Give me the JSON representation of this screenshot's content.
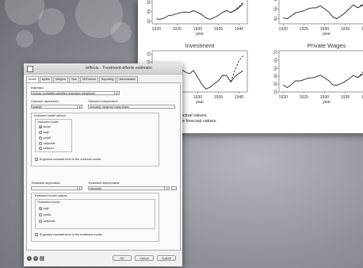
{
  "graph": {
    "panels": [
      {
        "title": "",
        "yticks": [
          "40",
          "60",
          "80"
        ],
        "xticks": [
          "1920",
          "1925",
          "1930",
          "1935",
          "1940"
        ],
        "xlabel": "year"
      },
      {
        "title": "",
        "yticks": [
          "40",
          "50",
          "60"
        ],
        "xticks": [
          "1920",
          "1925",
          "1930",
          "1935",
          "1940"
        ],
        "xlabel": "year"
      },
      {
        "title": "Investment",
        "yticks": [
          "-5",
          "0",
          "5",
          "10",
          "15"
        ],
        "xticks": [
          "1920",
          "1925",
          "1930",
          "1935",
          "1940"
        ],
        "xlabel": "year"
      },
      {
        "title": "Private Wages",
        "yticks": [
          "20",
          "30",
          "40",
          "50",
          "60",
          "70"
        ],
        "xticks": [
          "1920",
          "1925",
          "1930",
          "1935",
          "1940"
        ],
        "xlabel": "year"
      }
    ],
    "note_line1": "Solid lines denote actual values.",
    "note_line2": "Dashed lines denote forecast values."
  },
  "dialog": {
    "title": "teffects - Treatment-effects estimatio",
    "tabs": [
      "Model",
      "by/if/in",
      "Weights",
      "Stat",
      "SE/Robust",
      "Reporting",
      "Maximization"
    ],
    "estimator_label": "Estimator",
    "estimator_value": "Inverse-probability-weighted regression adjustment",
    "outcome_dependent_label": "Outcome dependent:",
    "outcome_dependent_value": "bweight",
    "outcome_independent_label": "Outcome independent:",
    "outcome_independent_value": "prenatal1 mmarried mage fbaby",
    "outcome_model_options_label": "Outcome model options",
    "outcome_model_label": "Outcome model",
    "outcome_models": [
      "linear",
      "logit",
      "probit",
      "hetprobit",
      "poisson"
    ],
    "suppress_outcome_label": "Suppress constant term in the outcome model",
    "treatment_dependent_label": "Treatment dependent:",
    "treatment_independent_label": "Treatment independent:",
    "treatment_independent_value": "mbsmoke",
    "treatment_model_options_label": "Treatment model options",
    "treatment_model_label": "Treatment model",
    "treatment_models": [
      "logit",
      "probit",
      "hetprobit"
    ],
    "suppress_treatment_label": "Suppress constant term in the treatment model",
    "ok_label": "OK",
    "cancel_label": "Cancel",
    "submit_label": "Submit",
    "ellipsis_label": "..."
  },
  "chart_data": [
    {
      "type": "line",
      "title": "",
      "xlabel": "year",
      "ylim": [
        35,
        90
      ],
      "x": [
        1920,
        1921,
        1922,
        1923,
        1924,
        1925,
        1926,
        1927,
        1928,
        1929,
        1930,
        1931,
        1932,
        1933,
        1934,
        1935,
        1936,
        1937,
        1938,
        1939,
        1940,
        1941
      ],
      "series": [
        {
          "values": [
            45,
            44,
            47,
            52,
            53,
            56,
            58,
            59,
            58,
            62,
            58,
            54,
            47,
            44,
            48,
            52,
            58,
            62,
            58,
            62,
            68,
            76
          ]
        },
        {
          "values": [
            null,
            null,
            null,
            null,
            null,
            null,
            null,
            null,
            null,
            null,
            null,
            null,
            null,
            null,
            null,
            null,
            null,
            null,
            58,
            63,
            70,
            79
          ]
        }
      ]
    },
    {
      "type": "line",
      "title": "",
      "xlabel": "year",
      "ylim": [
        35,
        62
      ],
      "x": [
        1920,
        1921,
        1922,
        1923,
        1924,
        1925,
        1926,
        1927,
        1928,
        1929,
        1930,
        1931,
        1932,
        1933,
        1934,
        1935,
        1936,
        1937,
        1938,
        1939,
        1940,
        1941
      ],
      "series": [
        {
          "values": [
            41,
            40,
            43,
            46,
            47,
            48,
            50,
            51,
            51,
            53,
            50,
            47,
            42,
            40,
            43,
            46,
            50,
            54,
            51,
            53,
            56,
            60
          ]
        },
        {
          "values": [
            null,
            null,
            null,
            null,
            null,
            null,
            null,
            null,
            null,
            null,
            null,
            null,
            null,
            null,
            null,
            null,
            null,
            null,
            51,
            54,
            57,
            61
          ]
        }
      ]
    },
    {
      "type": "line",
      "title": "Investment",
      "xlabel": "year",
      "ylim": [
        -8,
        17
      ],
      "x": [
        1920,
        1921,
        1922,
        1923,
        1924,
        1925,
        1926,
        1927,
        1928,
        1929,
        1930,
        1931,
        1932,
        1933,
        1934,
        1935,
        1936,
        1937,
        1938,
        1939,
        1940,
        1941
      ],
      "series": [
        {
          "values": [
            2.7,
            -0.2,
            1.9,
            5.2,
            3.0,
            5.1,
            5.6,
            4.2,
            3.0,
            5.1,
            1.0,
            -3.4,
            -6.2,
            -5.1,
            -3.0,
            -1.3,
            2.1,
            2.0,
            -1.9,
            1.3,
            3.3,
            4.9
          ]
        },
        {
          "values": [
            null,
            null,
            null,
            null,
            null,
            null,
            null,
            null,
            null,
            null,
            null,
            null,
            null,
            null,
            null,
            null,
            null,
            null,
            -1.9,
            5.0,
            11.0,
            14.0
          ]
        }
      ]
    },
    {
      "type": "line",
      "title": "Private Wages",
      "xlabel": "year",
      "ylim": [
        20,
        72
      ],
      "x": [
        1920,
        1921,
        1922,
        1923,
        1924,
        1925,
        1926,
        1927,
        1928,
        1929,
        1930,
        1931,
        1932,
        1933,
        1934,
        1935,
        1936,
        1937,
        1938,
        1939,
        1940,
        1941
      ],
      "series": [
        {
          "values": [
            28.8,
            25.5,
            29.3,
            34.1,
            33.9,
            35.4,
            37.4,
            37.9,
            39.2,
            41.3,
            37.9,
            34.5,
            29.0,
            28.5,
            30.6,
            33.2,
            36.8,
            41.0,
            38.2,
            41.6,
            45.0,
            53.3
          ]
        },
        {
          "values": [
            null,
            null,
            null,
            null,
            null,
            null,
            null,
            null,
            null,
            null,
            null,
            null,
            null,
            null,
            null,
            null,
            null,
            null,
            38.2,
            43.0,
            50.0,
            58.0
          ]
        }
      ]
    }
  ]
}
